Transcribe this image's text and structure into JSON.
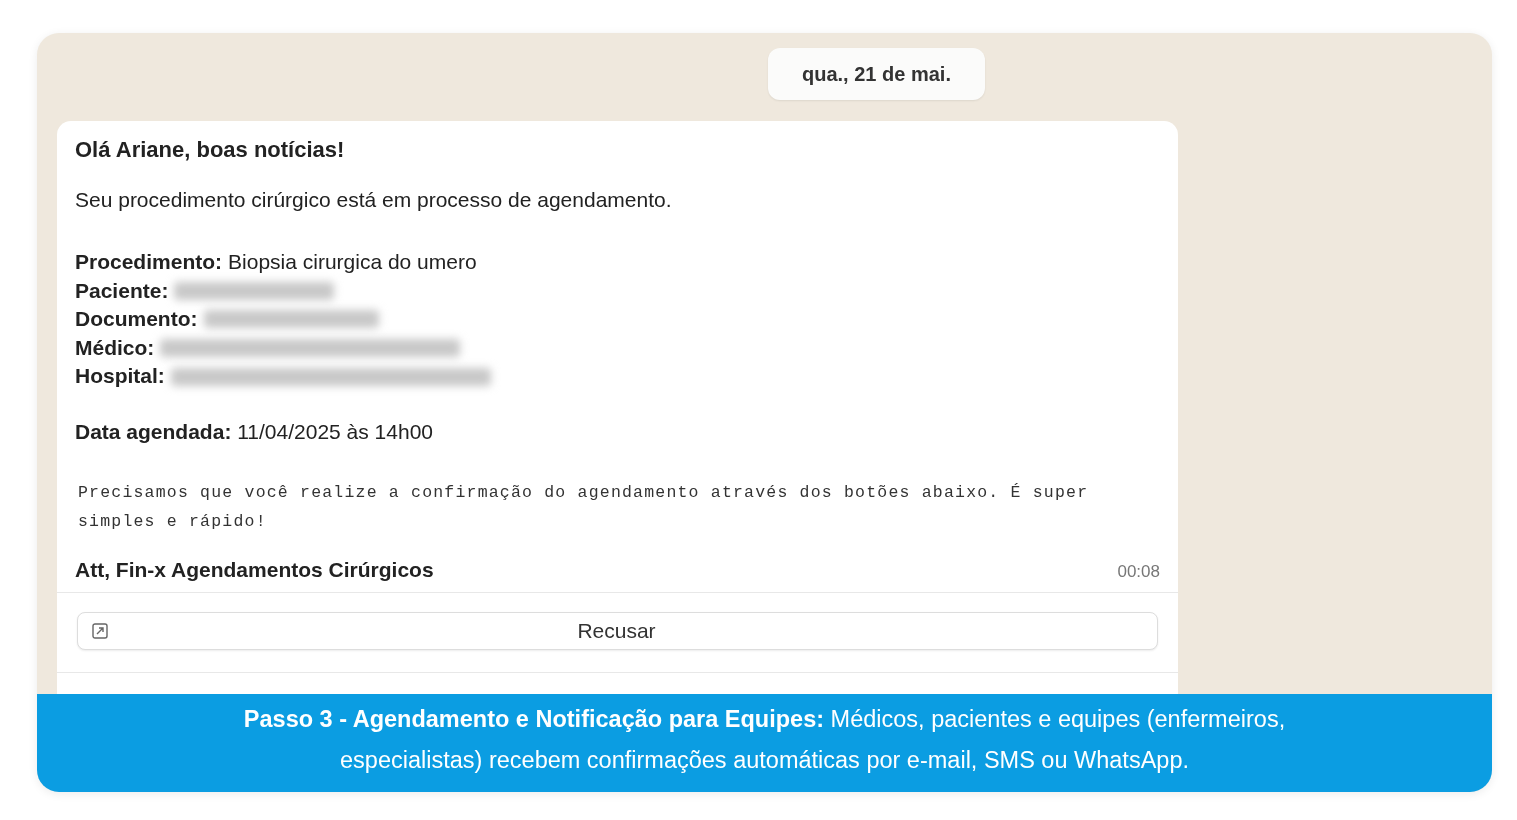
{
  "date_chip": "qua., 21 de mai.",
  "message": {
    "greeting": "Olá Ariane, boas notícias!",
    "intro": "Seu procedimento cirúrgico está em processo de agendamento.",
    "fields": [
      {
        "label": "Procedimento:",
        "kind": "text",
        "value": "Biopsia cirurgica do umero"
      },
      {
        "label": "Paciente:",
        "kind": "redacted"
      },
      {
        "label": "Documento:",
        "kind": "redacted"
      },
      {
        "label": "Médico:",
        "kind": "redacted"
      },
      {
        "label": "Hospital:",
        "kind": "redacted"
      }
    ],
    "schedule": {
      "label": "Data agendada:",
      "value": "11/04/2025 às 14h00"
    },
    "note": "Precisamos que você realize a confirmação do agendamento através dos botões abaixo. É super simples e rápido!",
    "signature": "Att, Fin-x Agendamentos Cirúrgicos",
    "time": "00:08",
    "buttons": [
      {
        "label": "Recusar"
      }
    ]
  },
  "caption": "**Passo 3 - Agendamento e Notificação para Equipes:** Médicos, pacientes e equipes (enfermeiros, especialistas) recebem confirmações automáticas por e-mail, SMS ou WhatsApp."
}
